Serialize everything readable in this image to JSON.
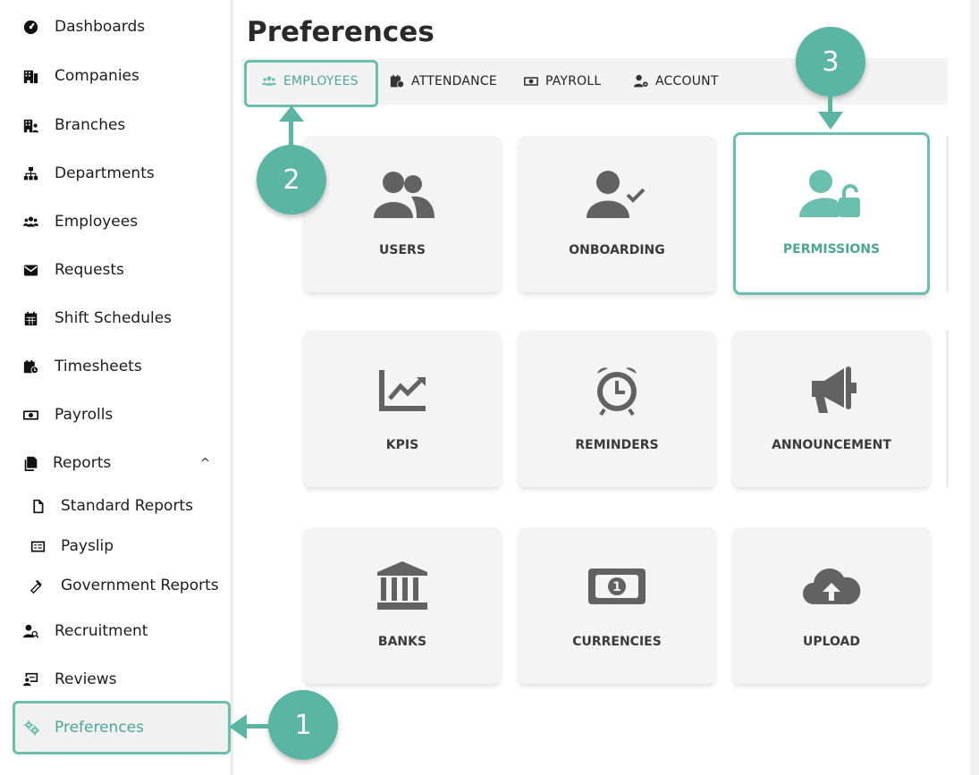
{
  "sidebar": {
    "items": [
      {
        "label": "Dashboards",
        "icon": "tachometer-icon"
      },
      {
        "label": "Companies",
        "icon": "building-icon"
      },
      {
        "label": "Branches",
        "icon": "branch-building-icon"
      },
      {
        "label": "Departments",
        "icon": "sitemap-icon"
      },
      {
        "label": "Employees",
        "icon": "users-icon"
      },
      {
        "label": "Requests",
        "icon": "envelope-icon"
      },
      {
        "label": "Shift Schedules",
        "icon": "calendar-icon"
      },
      {
        "label": "Timesheets",
        "icon": "calendar-clock-icon"
      },
      {
        "label": "Payrolls",
        "icon": "money-bill-icon"
      },
      {
        "label": "Reports",
        "icon": "copy-icon"
      },
      {
        "label": "Standard Reports",
        "icon": "file-icon"
      },
      {
        "label": "Payslip",
        "icon": "receipt-icon"
      },
      {
        "label": "Government Reports",
        "icon": "gavel-icon"
      },
      {
        "label": "Recruitment",
        "icon": "user-search-icon"
      },
      {
        "label": "Reviews",
        "icon": "review-icon"
      },
      {
        "label": "Preferences",
        "icon": "cogs-icon"
      }
    ],
    "reports_caret": "^"
  },
  "page": {
    "title": "Preferences"
  },
  "tabs": [
    {
      "label": "EMPLOYEES",
      "icon": "users-icon",
      "active": true
    },
    {
      "label": "ATTENDANCE",
      "icon": "calendar-clock-icon",
      "active": false
    },
    {
      "label": "PAYROLL",
      "icon": "money-bill-icon",
      "active": false
    },
    {
      "label": "ACCOUNT",
      "icon": "user-cog-icon",
      "active": false
    }
  ],
  "cards": [
    {
      "label": "USERS",
      "icon": "user-group-icon"
    },
    {
      "label": "ONBOARDING",
      "icon": "user-check-icon"
    },
    {
      "label": "PERMISSIONS",
      "icon": "user-lock-icon"
    },
    {
      "label": "KPIS",
      "icon": "chart-line-icon"
    },
    {
      "label": "REMINDERS",
      "icon": "alarm-clock-icon"
    },
    {
      "label": "ANNOUNCEMENT",
      "icon": "megaphone-icon"
    },
    {
      "label": "BANKS",
      "icon": "bank-icon"
    },
    {
      "label": "CURRENCIES",
      "icon": "money-bill-icon"
    },
    {
      "label": "UPLOAD",
      "icon": "cloud-upload-icon"
    }
  ],
  "steps": [
    "1",
    "2",
    "3"
  ],
  "colors": {
    "accent": "#6abfae",
    "step": "#5bb5a3",
    "card_bg": "#f4f4f4",
    "icon_gray": "#626262"
  }
}
